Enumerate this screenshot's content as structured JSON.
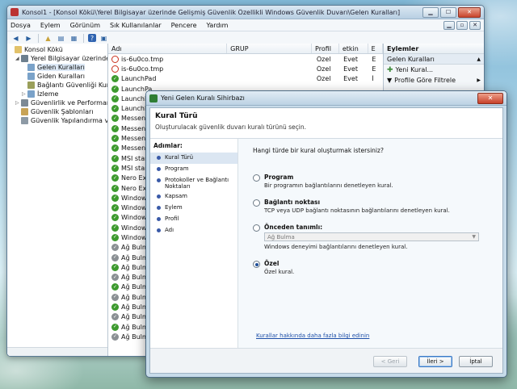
{
  "main_window": {
    "title": "Konsol1 - [Konsol Kökü\\Yerel Bilgisayar üzerinde Gelişmiş Güvenlik Özellikli Windows Güvenlik Duvarı\\Gelen Kuralları]",
    "min_label": "▁",
    "max_label": "☐",
    "close_label": "✕",
    "child_min_label": "▁",
    "child_max_label": "▫",
    "child_close_label": "✕"
  },
  "menu": [
    "Dosya",
    "Eylem",
    "Görünüm",
    "Sık Kullanılanlar",
    "Pencere",
    "Yardım"
  ],
  "tree": [
    {
      "label": "Konsol Kökü",
      "indent": 0,
      "exp": "",
      "icon": "folder-icon",
      "color": "#e2c26a"
    },
    {
      "label": "Yerel Bilgisayar üzerinde Ge",
      "indent": 1,
      "exp": "◢",
      "icon": "firewall-icon",
      "color": "#6d7f8e"
    },
    {
      "label": "Gelen Kuralları",
      "indent": 2,
      "exp": "",
      "icon": "inbound-rules-icon",
      "color": "#7aa2c9",
      "selected": true
    },
    {
      "label": "Giden Kuralları",
      "indent": 2,
      "exp": "",
      "icon": "outbound-rules-icon",
      "color": "#7aa2c9"
    },
    {
      "label": "Bağlantı Güvenliği Kural",
      "indent": 2,
      "exp": "",
      "icon": "connection-security-icon",
      "color": "#9a9f5a"
    },
    {
      "label": "İzleme",
      "indent": 2,
      "exp": "▷",
      "icon": "monitoring-icon",
      "color": "#7aa2c9"
    },
    {
      "label": "Güvenlirlik ve Performans (",
      "indent": 1,
      "exp": "▷",
      "icon": "performance-icon",
      "color": "#7d8a95"
    },
    {
      "label": "Güvenlik Şablonları",
      "indent": 1,
      "exp": "",
      "icon": "templates-icon",
      "color": "#c8a356"
    },
    {
      "label": "Güvenlik Yapılandırma ve Ç",
      "indent": 1,
      "exp": "",
      "icon": "security-config-icon",
      "color": "#8d9aa5"
    }
  ],
  "list": {
    "headers": [
      "Adı",
      "GRUP",
      "Profil",
      "etkin",
      "E"
    ],
    "rows": [
      {
        "name": "is-6u0co.tmp",
        "profile": "Özel",
        "enabled": "Evet",
        "e": "E",
        "status": "block"
      },
      {
        "name": "is-6u0co.tmp",
        "profile": "Özel",
        "enabled": "Evet",
        "e": "E",
        "status": "block"
      },
      {
        "name": "LaunchPad",
        "profile": "Özel",
        "enabled": "Evet",
        "e": "İ",
        "status": "allow"
      },
      {
        "name": "LaunchPa",
        "profile": "",
        "enabled": "",
        "e": "",
        "status": "allow"
      },
      {
        "name": "LaunchPa",
        "profile": "",
        "enabled": "",
        "e": "",
        "status": "allow"
      },
      {
        "name": "LaunchPa",
        "profile": "",
        "enabled": "",
        "e": "",
        "status": "allow"
      },
      {
        "name": "Messeng",
        "profile": "",
        "enabled": "",
        "e": "",
        "status": "allow"
      },
      {
        "name": "Messeng",
        "profile": "",
        "enabled": "",
        "e": "",
        "status": "allow"
      },
      {
        "name": "Messeng",
        "profile": "",
        "enabled": "",
        "e": "",
        "status": "allow"
      },
      {
        "name": "Messeng",
        "profile": "",
        "enabled": "",
        "e": "",
        "status": "allow"
      },
      {
        "name": "MSI start",
        "profile": "",
        "enabled": "",
        "e": "",
        "status": "allow"
      },
      {
        "name": "MSI start",
        "profile": "",
        "enabled": "",
        "e": "",
        "status": "allow"
      },
      {
        "name": "Nero Exp",
        "profile": "",
        "enabled": "",
        "e": "",
        "status": "allow"
      },
      {
        "name": "Nero Exp",
        "profile": "",
        "enabled": "",
        "e": "",
        "status": "allow"
      },
      {
        "name": "Windows",
        "profile": "",
        "enabled": "",
        "e": "",
        "status": "allow"
      },
      {
        "name": "Windows",
        "profile": "",
        "enabled": "",
        "e": "",
        "status": "allow"
      },
      {
        "name": "Windows",
        "profile": "",
        "enabled": "",
        "e": "",
        "status": "allow"
      },
      {
        "name": "Windows",
        "profile": "",
        "enabled": "",
        "e": "",
        "status": "allow"
      },
      {
        "name": "Windows",
        "profile": "",
        "enabled": "",
        "e": "",
        "status": "allow"
      },
      {
        "name": "Ağ Bulm",
        "profile": "",
        "enabled": "",
        "e": "",
        "status": "disabled"
      },
      {
        "name": "Ağ Bulm",
        "profile": "",
        "enabled": "",
        "e": "",
        "status": "disabled"
      },
      {
        "name": "Ağ Bulm",
        "profile": "",
        "enabled": "",
        "e": "",
        "status": "allow"
      },
      {
        "name": "Ağ Bulm",
        "profile": "",
        "enabled": "",
        "e": "",
        "status": "disabled"
      },
      {
        "name": "Ağ Bulm",
        "profile": "",
        "enabled": "",
        "e": "",
        "status": "allow"
      },
      {
        "name": "Ağ Bulm",
        "profile": "",
        "enabled": "",
        "e": "",
        "status": "disabled"
      },
      {
        "name": "Ağ Bulm",
        "profile": "",
        "enabled": "",
        "e": "",
        "status": "allow"
      },
      {
        "name": "Ağ Bulm",
        "profile": "",
        "enabled": "",
        "e": "",
        "status": "disabled"
      },
      {
        "name": "Ağ Bulm",
        "profile": "",
        "enabled": "",
        "e": "",
        "status": "allow"
      },
      {
        "name": "Ağ Bulm",
        "profile": "",
        "enabled": "",
        "e": "",
        "status": "disabled"
      }
    ]
  },
  "actions": {
    "title": "Eylemler",
    "section": "Gelen Kuralları",
    "items": [
      "Yeni Kural...",
      "Profile Göre Filtrele"
    ]
  },
  "dialog": {
    "title": "Yeni Gelen Kuralı Sihirbazı",
    "close_label": "✕",
    "heading": "Kural Türü",
    "subheading": "Oluşturulacak güvenlik duvarı kuralı türünü seçin.",
    "steps_title": "Adımlar:",
    "steps": [
      "Kural Türü",
      "Program",
      "Protokoller ve Bağlantı Noktaları",
      "Kapsam",
      "Eylem",
      "Profil",
      "Adı"
    ],
    "question": "Hangi türde bir kural oluşturmak istersiniz?",
    "options": [
      {
        "label": "Program",
        "desc": "Bir programın bağlantılarını denetleyen kural."
      },
      {
        "label": "Bağlantı noktası",
        "desc": "TCP veya UDP bağlantı noktasının bağlantılarını denetleyen kural."
      },
      {
        "label": "Önceden tanımlı:",
        "desc": "Windows deneyimi bağlantılarını denetleyen kural.",
        "dropdown": "Ağ Bulma"
      },
      {
        "label": "Özel",
        "desc": "Özel kural."
      }
    ],
    "selected_option": 3,
    "learn_link": "Kurallar hakkında daha fazla bilgi edinin",
    "back_label": "< Geri",
    "next_label": "İleri >",
    "cancel_label": "İptal"
  }
}
